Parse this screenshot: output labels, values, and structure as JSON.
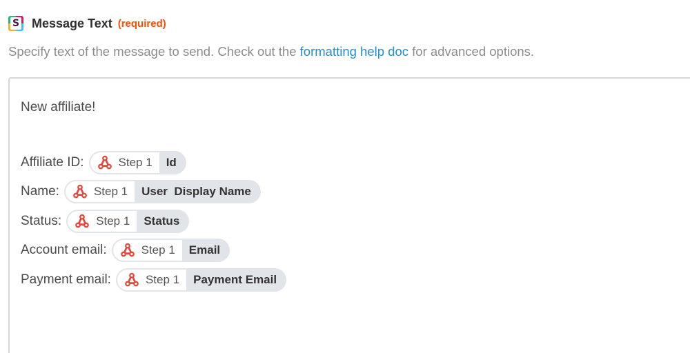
{
  "header": {
    "app_icon_letter": "S",
    "title": "Message Text",
    "required_label": "(required)",
    "colors": {
      "required": "#ff4a00",
      "link": "#1f8dd6"
    }
  },
  "help": {
    "prefix": "Specify text of the message to send. Check out the ",
    "link_text": "formatting help doc",
    "suffix": " for advanced options."
  },
  "editor": {
    "first_line": "New affiliate!",
    "rows": [
      {
        "label": "Affiliate ID:",
        "step": "Step 1",
        "field": "Id"
      },
      {
        "label": "Name:",
        "step": "Step 1",
        "field": "User  Display Name"
      },
      {
        "label": "Status:",
        "step": "Step 1",
        "field": "Status"
      },
      {
        "label": "Account email:",
        "step": "Step 1",
        "field": "Email"
      },
      {
        "label": "Payment email:",
        "step": "Step 1",
        "field": "Payment Email"
      }
    ],
    "pill_icon": "webhook-icon"
  }
}
